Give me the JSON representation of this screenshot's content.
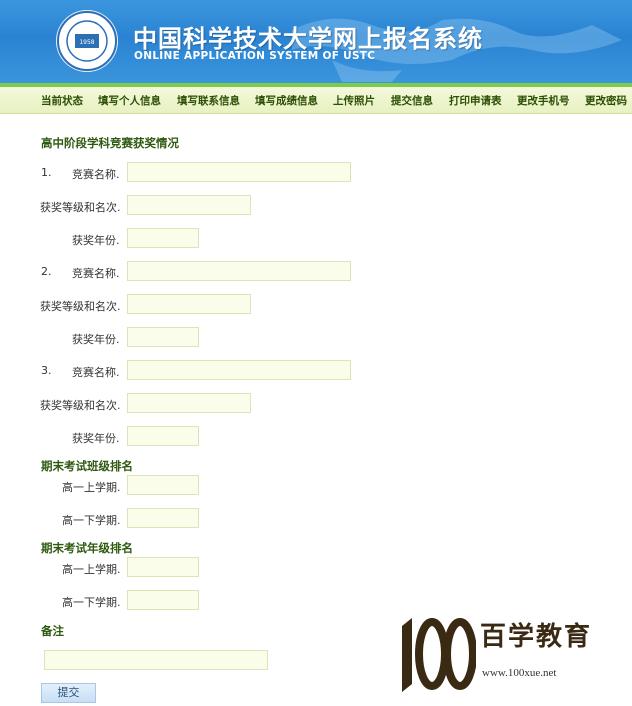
{
  "header": {
    "title_cn": "中国科学技术大学网上报名系统",
    "title_en": "ONLINE APPLICATION SYSTEM OF USTC",
    "emblem_year": "1958"
  },
  "nav": {
    "items": [
      "当前状态",
      "填写个人信息",
      "填写联系信息",
      "填写成绩信息",
      "上传照片",
      "提交信息",
      "打印申请表",
      "更改手机号",
      "更改密码"
    ]
  },
  "competition": {
    "section_title": "高中阶段学科竞赛获奖情况",
    "entries": [
      {
        "number": "1.",
        "name_label": "竞赛名称.",
        "level_label": "获奖等级和名次.",
        "year_label": "获奖年份."
      },
      {
        "number": "2.",
        "name_label": "竞赛名称.",
        "level_label": "获奖等级和名次.",
        "year_label": "获奖年份."
      },
      {
        "number": "3.",
        "name_label": "竞赛名称.",
        "level_label": "获奖等级和名次.",
        "year_label": "获奖年份."
      }
    ]
  },
  "class_rank": {
    "section_title": "期末考试班级排名",
    "first_term_label": "高一上学期.",
    "second_term_label": "高一下学期."
  },
  "grade_rank": {
    "section_title": "期末考试年级排名",
    "first_term_label": "高一上学期.",
    "second_term_label": "高一下学期."
  },
  "notes": {
    "section_title": "备注"
  },
  "submit": {
    "label": "提交"
  },
  "watermark": {
    "number": "100",
    "cn": "百学教育",
    "url": "www.100xue.net"
  }
}
